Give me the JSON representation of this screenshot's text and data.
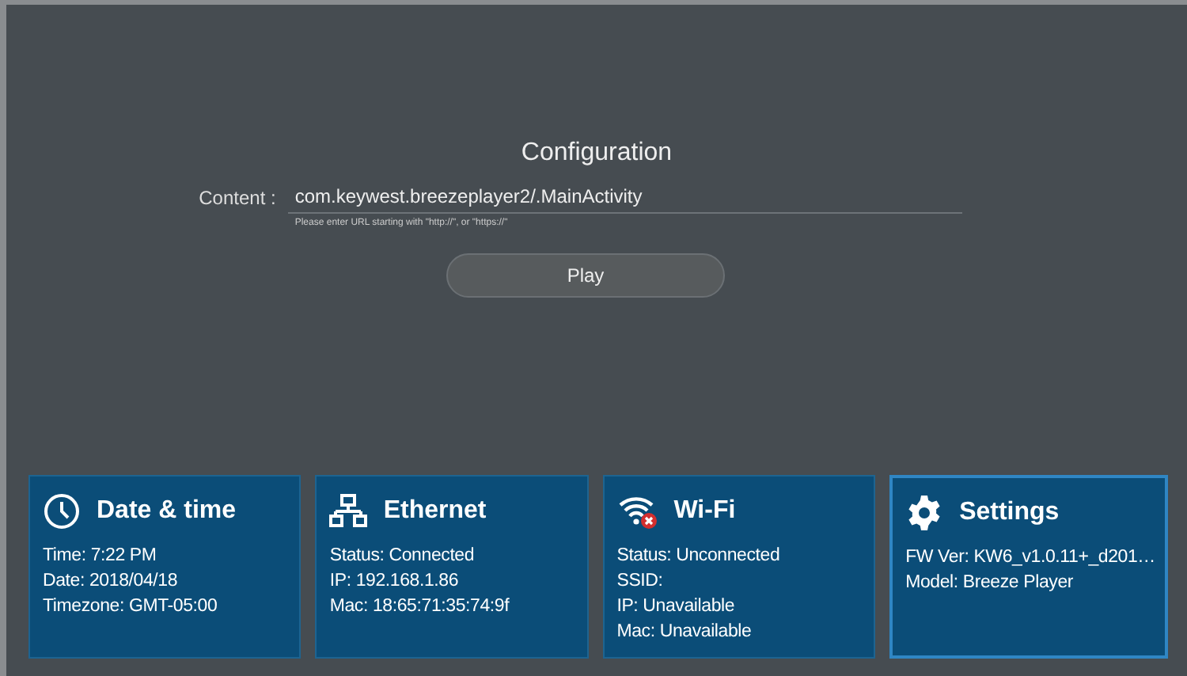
{
  "title": "Configuration",
  "content_field": {
    "label": "Content :",
    "value": "com.keywest.breezeplayer2/.MainActivity",
    "hint": "Please enter URL starting with \"http://\", or \"https://\""
  },
  "play_button": "Play",
  "cards": [
    {
      "kind": "clock",
      "title": "Date & time",
      "selected": false,
      "lines": [
        "Time: 7:22 PM",
        "Date: 2018/04/18",
        "Timezone: GMT-05:00"
      ]
    },
    {
      "kind": "ethernet",
      "title": "Ethernet",
      "selected": false,
      "lines": [
        "Status: Connected",
        "IP: 192.168.1.86",
        "Mac: 18:65:71:35:74:9f"
      ]
    },
    {
      "kind": "wifi",
      "title": "Wi-Fi",
      "selected": false,
      "lines": [
        "Status: Unconnected",
        "SSID:",
        "IP: Unavailable",
        "Mac: Unavailable"
      ]
    },
    {
      "kind": "settings",
      "title": "Settings",
      "selected": true,
      "lines": [
        "FW Ver: KW6_v1.0.11+_d201…",
        "Model: Breeze Player"
      ]
    }
  ]
}
